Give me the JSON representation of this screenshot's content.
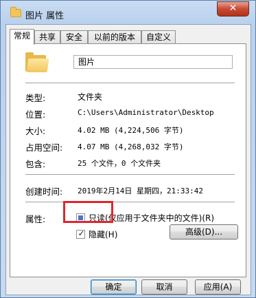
{
  "window": {
    "title": "图片 属性",
    "close_label": "✕"
  },
  "tabs": [
    "常规",
    "共享",
    "安全",
    "以前的版本",
    "自定义"
  ],
  "general": {
    "folder_name": "图片",
    "rows": [
      {
        "label": "类型:",
        "value": "文件夹"
      },
      {
        "label": "位置:",
        "value": "C:\\Users\\Administrator\\Desktop"
      },
      {
        "label": "大小:",
        "value": "4.02 MB (4,224,506 字节)"
      },
      {
        "label": "占用空间:",
        "value": "4.07 MB (4,268,032 字节)"
      },
      {
        "label": "包含:",
        "value": "25 个文件，0 个文件夹"
      },
      {
        "label": "创建时间:",
        "value": "2019年2月14日 星期四，21:33:42"
      }
    ],
    "attributes_label": "属性:",
    "readonly_label": "只读(仅应用于文件夹中的文件)(R)",
    "readonly_state": "indeterminate",
    "hidden_label": "隐藏(H)",
    "hidden_checked": true,
    "advanced_label": "高级(D)..."
  },
  "buttons": {
    "ok": "确定",
    "cancel": "取消",
    "apply": "应用(A)"
  },
  "icons": {
    "title": "folder-icon",
    "large": "folder-icon",
    "close": "close-icon"
  },
  "colors": {
    "highlight": "#e0262b",
    "title_bar": "#b9d1ee",
    "close": "#c74a35"
  }
}
